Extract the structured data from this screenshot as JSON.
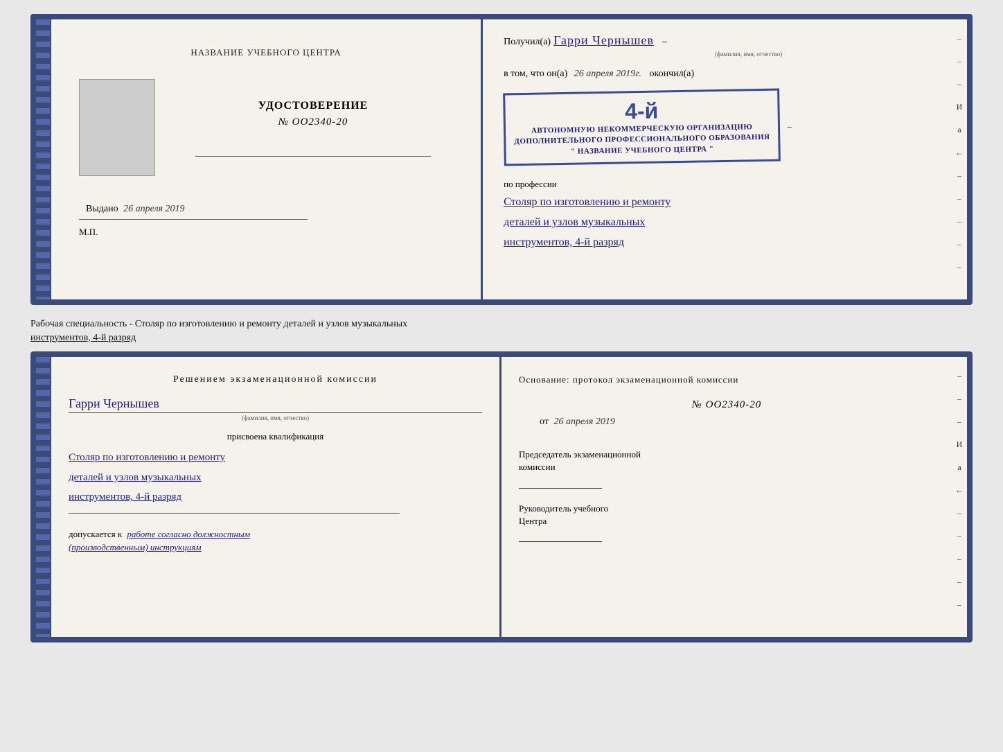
{
  "page": {
    "background": "#e8e8e8"
  },
  "subtitle": {
    "text": "Рабочая специальность - Столяр по изготовлению и ремонту деталей и узлов музыкальных",
    "text2": "инструментов, 4-й разряд"
  },
  "diploma": {
    "left": {
      "center_title": "НАЗВАНИЕ УЧЕБНОГО ЦЕНТРА",
      "udostoverenie_label": "УДОСТОВЕРЕНИЕ",
      "number": "№ OO2340-20",
      "vydano_label": "Выдано",
      "vydano_date": "26 апреля 2019",
      "mp_label": "М.П."
    },
    "right": {
      "poluchil_label": "Получил(а)",
      "name_handwriting": "Гарри Чернышев",
      "fio_subtitle": "(фамилия, имя, отчество)",
      "dash": "–",
      "vtom_label": "в том, что он(а)",
      "date_value": "26 апреля 2019г.",
      "okonchil_label": "окончил(а)",
      "stamp_4y": "4-й",
      "stamp_line1": "АВТОНОМНУЮ НЕКОММЕРЧЕСКУЮ ОРГАНИЗАЦИЮ",
      "stamp_line2": "ДОПОЛНИТЕЛЬНОГО ПРОФЕССИОНАЛЬНОГО ОБРАЗОВАНИЯ",
      "stamp_line3": "\" НАЗВАНИЕ УЧЕБНОГО ЦЕНТРА \"",
      "po_professii_label": "по профессии",
      "profession_line1": "Столяр по изготовлению и ремонту",
      "profession_line2": "деталей и узлов музыкальных",
      "profession_line3": "инструментов, 4-й разряд"
    }
  },
  "bottom": {
    "left": {
      "resheniyem_label": "Решением  экзаменационной  комиссии",
      "name_handwriting": "Гарри Чернышев",
      "fio_subtitle": "(фамилия, имя, отчество)",
      "prisvoena_label": "присвоена квалификация",
      "qualification_line1": "Столяр по изготовлению и ремонту",
      "qualification_line2": "деталей и узлов музыкальных",
      "qualification_line3": "инструментов, 4-й разряд",
      "dopuskaetsya_prefix": "допускается к",
      "dopuskaetsya_text": "работе согласно должностным",
      "dopuskaetsya_text2": "(производственным) инструкциям"
    },
    "right": {
      "osnovanie_label": "Основание: протокол экзаменационной  комиссии",
      "number": "№  OO2340-20",
      "ot_label": "от",
      "ot_date": "26 апреля 2019",
      "predsedatel_label": "Председатель экзаменационной",
      "predsedatel_label2": "комиссии",
      "rukovoditel_label": "Руководитель учебного",
      "rukovoditel_label2": "Центра"
    }
  },
  "right_side_dashes": [
    "-",
    "-",
    "-",
    "И",
    "а",
    "←",
    "-",
    "-",
    "-",
    "-",
    "-"
  ]
}
